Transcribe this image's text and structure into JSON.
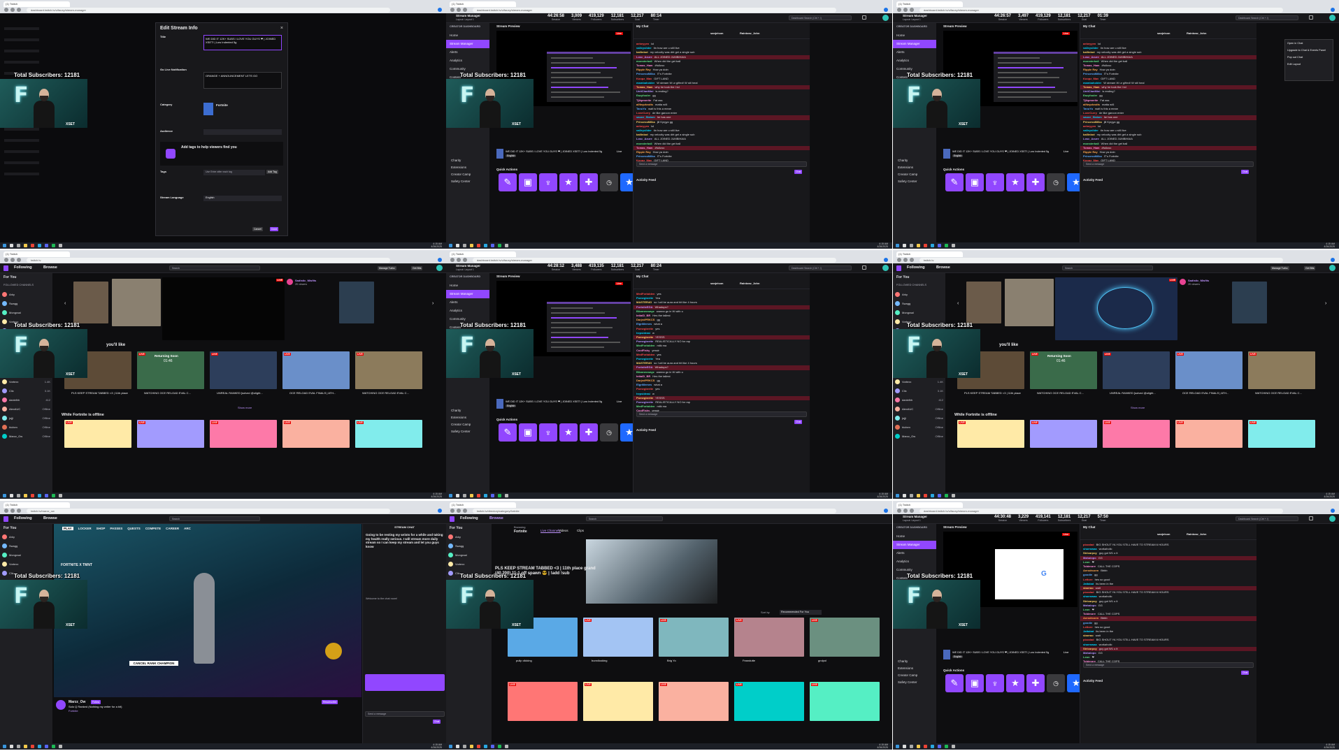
{
  "overlay": {
    "subscribers_text": "Total Subscribers: 12181",
    "brand": "XSET",
    "logo_letter": "F"
  },
  "browser": {
    "tab_twitch": "(1) Twitch",
    "tab_dashboard": "(1) Twitch",
    "url_dashboard": "dashboard.twitch.tv/u/fauxy/stream-manager",
    "url_home": "twitch.tv",
    "url_channel": "twitch.tv/marzz_ow",
    "url_category": "twitch.tv/directory/category/fortnite"
  },
  "clock": {
    "time": "4:15 AM",
    "date": "4/26/2025"
  },
  "colors": {
    "accent": "#9147ff",
    "live": "#eb0400",
    "bg": "#0e0e10",
    "panel": "#18181b"
  },
  "dashboard": {
    "title": "Stream Manager",
    "subtitle": "Layout: Layout 1",
    "creator_dashboard": "CREATOR DASHBOARD",
    "nav": [
      "Home",
      "Stream Manager",
      "Alerts",
      "Analytics",
      "Community",
      "Content",
      "Monetization"
    ],
    "nav_bottom": [
      "Charity",
      "Extensions",
      "Creator Camp",
      "Safety Center"
    ],
    "preview_label": "Stream Preview",
    "chat_label": "My Chat",
    "quick_actions": "Quick Actions",
    "activity_feed": "Activity Feed",
    "search_placeholder": "Dashboard Search (Ctrl + /)",
    "send_message": "Send a message",
    "chat_button": "Chat",
    "live_label": "Live",
    "stream_title": "WE DID IT 12K+ SUBS I LOVE YOU GUYS ❤ | JOINED XSET! | Low Indented 5g",
    "category_short": "Fortnite",
    "language": "English",
    "quick_action_icons": [
      "pencil-icon",
      "clip-icon",
      "raid-icon",
      "star-icon",
      "add-user-icon"
    ],
    "stats": [
      {
        "label": "Session",
        "values": [
          "44:26:58",
          "44:26:57",
          "44:28:12",
          "44:30:48"
        ]
      },
      {
        "label": "Viewers",
        "values": [
          "3,009",
          "3,497",
          "3,488",
          "3,229"
        ]
      },
      {
        "label": "Followers",
        "values": [
          "419,129",
          "419,129",
          "419,135",
          "419,141"
        ]
      },
      {
        "label": "Subscribers",
        "values": [
          "12,181",
          "12,181",
          "12,181",
          "12,181"
        ]
      },
      {
        "label": "Goal",
        "values": [
          "12,217",
          "12,217",
          "12,217",
          "12,217"
        ]
      },
      {
        "label": "Timer",
        "values": [
          "80:14",
          "01:39",
          "80:24",
          "57:50"
        ]
      }
    ],
    "chat_users": [
      "sanjeison",
      "Rainbow_John"
    ],
    "chat_lines_a": [
      {
        "user": "aebeyyen",
        "text": "lol"
      },
      {
        "user": "valleyslider",
        "text": "tin how are u still live"
      },
      {
        "user": "ballinbot",
        "text": "my velocity was dirt get a single sub"
      },
      {
        "user": "Losc_Azure",
        "text": "ALL JOINED JUMBIHAIA"
      },
      {
        "user": "monsterball",
        "text": "When did the get ball"
      },
      {
        "user": "Tomas_Ham",
        "text": "#fullzoo"
      },
      {
        "user": "Ripple Ray",
        "text": "How ya doin"
      },
      {
        "user": "PrincessMilka",
        "text": "IT's Fortnite"
      },
      {
        "user": "Koopz_Mav",
        "text": "GIFT LAND"
      },
      {
        "user": "mambaholder",
        "text": "W stream W ur gifted! W stil heal"
      },
      {
        "user": "Tomas_Ham",
        "text": "why he took the l lol"
      },
      {
        "user": "UnitClanMini",
        "text": "is ending?"
      },
      {
        "user": "Eazyfooler",
        "text": "gg"
      },
      {
        "user": "Tjikpmerite",
        "text": "Fat ass"
      },
      {
        "user": "allfwyzbndts",
        "text": "matta w/6"
      },
      {
        "user": "TanuYu",
        "text": "wait is this a mean"
      },
      {
        "user": "LoveCurry",
        "text": "de like garcon enter"
      },
      {
        "user": "sauce_Slalom",
        "text": "he has one"
      },
      {
        "user": "PrincessMilka",
        "text": "jill Kyrgyz gg"
      }
    ],
    "chat_lines_b": [
      {
        "user": "MedForbdden",
        "text": "yes"
      },
      {
        "user": "Pomegbreite",
        "text": "Yea"
      },
      {
        "user": "MASTER4G",
        "text": "so I wil be aura and hit like 4 hours"
      },
      {
        "user": "FortniteEGA",
        "text": "Whadups?"
      },
      {
        "user": "Blizanecwayz",
        "text": "wanna go in W with u"
      },
      {
        "user": "IntialD_BR",
        "text": "Hes the tallest"
      },
      {
        "user": "DarjedPRKCS",
        "text": "gg"
      },
      {
        "user": "ElgnMemes",
        "text": "what a"
      },
      {
        "user": "Pomegbreite",
        "text": "yes"
      },
      {
        "user": "hepsidrasi",
        "text": "w"
      },
      {
        "user": "Pomegbreite",
        "text": "YESSS"
      },
      {
        "user": "Pomegbreite",
        "text": "REALISTICALLY NO for rap"
      },
      {
        "user": "MedForbdden",
        "text": "milk ma"
      },
      {
        "user": "CoolFishy",
        "text": "yessir"
      }
    ],
    "chat_lines_c": [
      {
        "user": "pizzalad",
        "text": "BIG SHOUT YA YOU STILL HAVE TO STREAM 6 HOURS"
      },
      {
        "user": "sharmwaa",
        "text": "wurkaholic"
      },
      {
        "user": "Stricarpoy",
        "text": "guy got W1 u it"
      },
      {
        "user": "Mahalopo",
        "text": "GG"
      },
      {
        "user": "Leon",
        "text": "❤"
      },
      {
        "user": "Tobimore",
        "text": "CALL THE COPS"
      },
      {
        "user": "Aerodrozen",
        "text": "Bbbb"
      },
      {
        "user": "goodie",
        "text": "gg"
      },
      {
        "user": "Lettore",
        "text": "hes so good"
      },
      {
        "user": "Jattabat",
        "text": "its been in the"
      },
      {
        "user": "sbarrao",
        "text": "wait"
      }
    ]
  },
  "edit_info": {
    "title": "Edit Stream Info",
    "title_label": "Title",
    "title_value": "WE DID IT 12K+ SUBS I LOVE YOU GUYS ❤ | JOINED XSET! | Low Indented 5g",
    "notif_label": "Go Live Notification",
    "notif_value": "ORANGE + ANNOUNCEMENT LETS GO",
    "category_label": "Category",
    "category_value": "Fortnite",
    "audience_label": "Audience",
    "tags_prompt": "Add tags to help viewers find you",
    "tags_label": "Tags",
    "tags_placeholder": "Use Enter after each tag",
    "add_tag": "Add Tag",
    "lang_label": "Stream Language",
    "lang_value": "English",
    "cancel": "Cancel",
    "done": "Done"
  },
  "home": {
    "following": "Following",
    "browse": "Browse",
    "search_placeholder": "Search",
    "for_you": "For You",
    "followed_channels": "FOLLOWED CHANNELS",
    "live_channels": "LIVE CHANNELS",
    "youd_like": "you'll like",
    "fortnite_offline": "While Fortnite is offline",
    "show_more": "Show more",
    "featured_channel": "Sadistic_Misfits",
    "featured_viewers": "2K viewers",
    "manage_turbo": "Manage Turbo",
    "get_bits": "Get Bits",
    "returning_soon": "Returning Soon",
    "returning_time": "01:46",
    "cards": [
      "PLS KEEP STREAM TABBED <3 | 11th place",
      "WATCHING OCE RELOAD EVAL C...",
      "UNREAL RANKED [solved @olight...",
      "OCE RELOAD EVAL FINALS | ATH...",
      "WATCHING OCE RELOAD EVAL C..."
    ],
    "channels": [
      "Arky",
      "Swagg",
      "Mongraal",
      "Vortexx",
      "Clix",
      "danielhh",
      "AlexAUC",
      "jojji",
      "hichen",
      "Marzz_Ow"
    ],
    "channel_viewers": [
      "1.2K",
      "2.3K",
      "895",
      "1.4K",
      "3.1K",
      "412",
      "Offline",
      "Offline",
      "Offline",
      "Offline"
    ]
  },
  "channel": {
    "name": "Marzz_Ow",
    "title": "Solo Q Ranked (Nothing my writer for a bit)",
    "category": "Fortnite",
    "lang": "English",
    "stream_chat": "STREAM CHAT",
    "tabs": [
      "PLAY",
      "LOCKER",
      "SHOP",
      "PASSES",
      "QUESTS",
      "COMPETE",
      "CAREER",
      "ARC"
    ],
    "game_text": "FORTNITE X TMNT",
    "cancel_label": "CANCEL RANK CHAMPION",
    "follow": "Follow",
    "resubscribe": "Resubscribe",
    "send_message": "Send a message",
    "chat_button": "Chat",
    "chat_msg": "Going to be resting my wrists for a while and taking my health really serious. I will stream more daily stream so I can keep my stream and let you guys know",
    "welcome": "Welcome to the chat room!"
  },
  "category": {
    "browsing": "Browsing",
    "game": "Fortnite",
    "tabs": [
      "Live Channels",
      "Videos",
      "Clips"
    ],
    "featured_title": "PLS KEEP STREAM TABBED <3 | 11th place grand (40,200) 11-1 off spawn 😎 | !add !sub",
    "viewers_label": "viewers",
    "sort_by": "Sort by",
    "sort_value": "Recommended For You",
    "cards": [
      "pulip clicking",
      "bunnilooking",
      "Brig Yo",
      "Feandutte",
      "grolpol"
    ]
  },
  "menu": {
    "items": [
      "Open in Chat",
      "Upgrade to Chat & Events Panel",
      "Pop out Chat",
      "Edit Layout"
    ]
  }
}
